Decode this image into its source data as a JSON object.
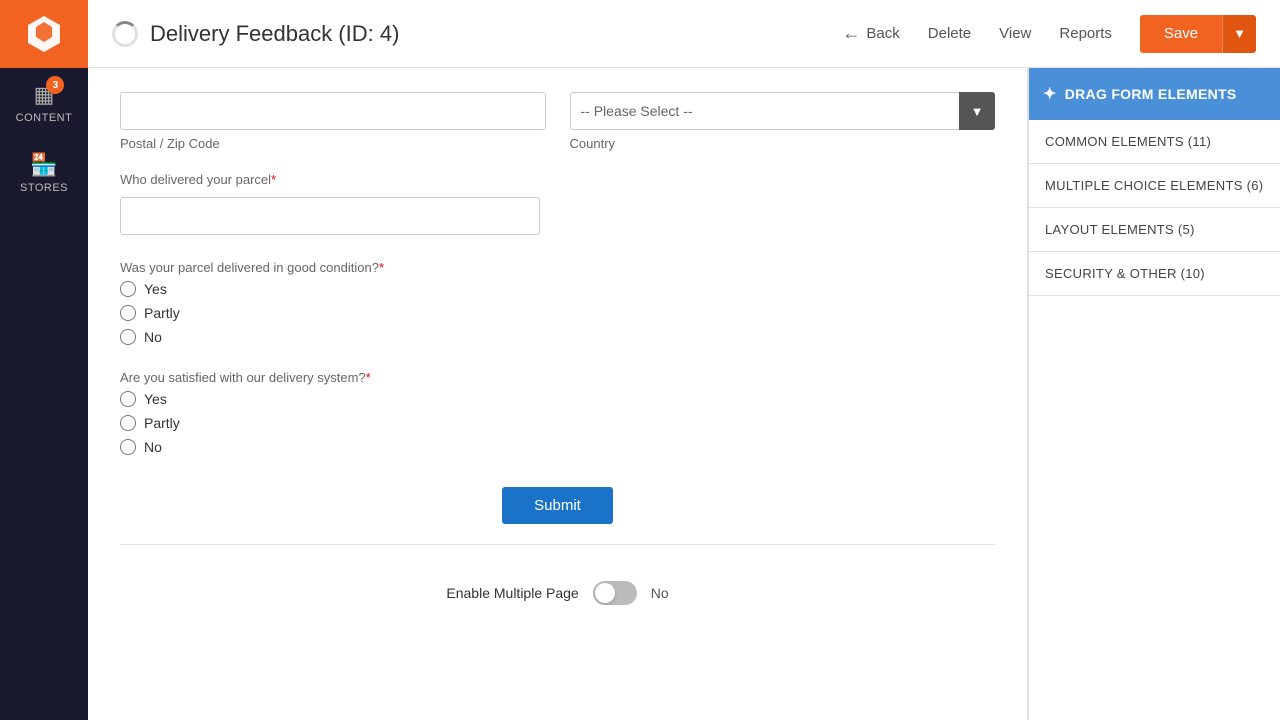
{
  "sidebar": {
    "logo_alt": "Magento Logo",
    "items": [
      {
        "id": "content",
        "label": "CONTENT",
        "icon": "▦",
        "badge": 3
      },
      {
        "id": "stores",
        "label": "STORES",
        "icon": "🏪",
        "badge": null
      }
    ]
  },
  "header": {
    "title": "Delivery Feedback (ID: 4)",
    "back_label": "Back",
    "delete_label": "Delete",
    "view_label": "View",
    "reports_label": "Reports",
    "save_label": "Save"
  },
  "form": {
    "postal_zip_label": "Postal / Zip Code",
    "postal_zip_value": "",
    "postal_zip_placeholder": "",
    "country_label": "Country",
    "country_placeholder": "-- Please Select --",
    "who_delivered_label": "Who delivered your parcel",
    "who_delivered_required": true,
    "who_delivered_value": "",
    "parcel_condition_label": "Was your parcel delivered in good condition?",
    "parcel_condition_required": true,
    "parcel_condition_options": [
      "Yes",
      "Partly",
      "No"
    ],
    "satisfied_label": "Are you satisfied with our delivery system?",
    "satisfied_required": true,
    "satisfied_options": [
      "Yes",
      "Partly",
      "No"
    ],
    "submit_label": "Submit",
    "multiple_page_label": "Enable Multiple Page",
    "multiple_page_value": false,
    "multiple_page_no": "No"
  },
  "right_panel": {
    "drag_label": "DRAG FORM ELEMENTS",
    "sections": [
      {
        "id": "common",
        "label": "COMMON ELEMENTS (11)"
      },
      {
        "id": "multiple",
        "label": "MULTIPLE CHOICE ELEMENTS (6)"
      },
      {
        "id": "layout",
        "label": "LAYOUT ELEMENTS (5)"
      },
      {
        "id": "security",
        "label": "SECURITY & OTHER (10)"
      }
    ]
  }
}
